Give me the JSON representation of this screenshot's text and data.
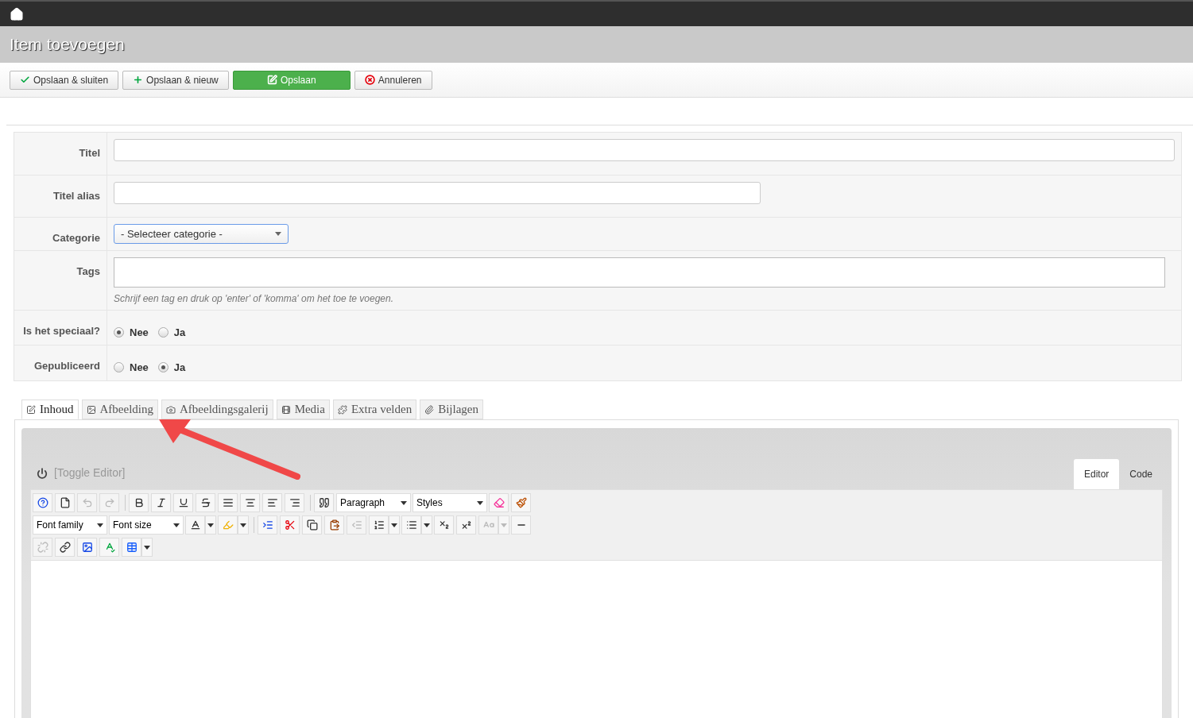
{
  "page_title": "Item toevoegen",
  "actions": [
    {
      "label": "Opslaan & sluiten",
      "kind": "check",
      "primary": false
    },
    {
      "label": "Opslaan & nieuw",
      "kind": "plus",
      "primary": false
    },
    {
      "label": "Opslaan",
      "kind": "edit",
      "primary": true
    },
    {
      "label": "Annuleren",
      "kind": "cancel",
      "primary": false
    }
  ],
  "form": [
    {
      "label": "Titel",
      "kind": "text-wide"
    },
    {
      "label": "Titel alias",
      "kind": "text"
    },
    {
      "label": "Categorie",
      "kind": "select",
      "value": "- Selecteer categorie -"
    },
    {
      "label": "Tags",
      "kind": "tags",
      "help": "Schrijf een tag en druk op 'enter' of 'komma' om het toe te voegen."
    },
    {
      "label": "Is het speciaal?",
      "kind": "radio",
      "options": [
        {
          "label": "Nee",
          "selected": true
        },
        {
          "label": "Ja",
          "selected": false
        }
      ]
    },
    {
      "label": "Gepubliceerd",
      "kind": "radio",
      "options": [
        {
          "label": "Nee",
          "selected": false
        },
        {
          "label": "Ja",
          "selected": true
        }
      ]
    }
  ],
  "tabs": [
    {
      "label": "Inhoud",
      "selected": true
    },
    {
      "label": "Afbeelding",
      "selected": false
    },
    {
      "label": "Afbeeldingsgalerij",
      "selected": false
    },
    {
      "label": "Media",
      "selected": false
    },
    {
      "label": "Extra velden",
      "selected": false
    },
    {
      "label": "Bijlagen",
      "selected": false
    }
  ],
  "editor": {
    "toggle": "[Toggle Editor]",
    "modes": [
      {
        "label": "Editor",
        "selected": true
      },
      {
        "label": "Code",
        "selected": false
      }
    ],
    "toolbar": [
      [
        {
          "kind": "button",
          "disabled": false
        },
        {
          "kind": "button",
          "disabled": false
        },
        {
          "kind": "button",
          "disabled": true
        },
        {
          "kind": "button",
          "disabled": true
        },
        {
          "kind": "separator"
        },
        {
          "kind": "button",
          "disabled": false
        },
        {
          "kind": "button",
          "disabled": false
        },
        {
          "kind": "button",
          "disabled": false
        },
        {
          "kind": "button",
          "disabled": false
        },
        {
          "kind": "button",
          "disabled": false
        },
        {
          "kind": "button",
          "disabled": false
        },
        {
          "kind": "button",
          "disabled": false
        },
        {
          "kind": "button",
          "disabled": false
        },
        {
          "kind": "separator"
        },
        {
          "kind": "button",
          "disabled": false
        },
        {
          "kind": "select",
          "label": "Paragraph"
        },
        {
          "kind": "select",
          "label": "Styles"
        },
        {
          "kind": "button",
          "disabled": false
        },
        {
          "kind": "button",
          "disabled": false
        }
      ],
      [
        {
          "kind": "select",
          "label": "Font family"
        },
        {
          "kind": "select",
          "label": "Font size"
        },
        {
          "kind": "split",
          "disabled": false
        },
        {
          "kind": "split",
          "disabled": false
        },
        {
          "kind": "separator"
        },
        {
          "kind": "button",
          "disabled": false
        },
        {
          "kind": "button",
          "disabled": false
        },
        {
          "kind": "button",
          "disabled": false
        },
        {
          "kind": "button",
          "disabled": false
        },
        {
          "kind": "button",
          "disabled": true
        },
        {
          "kind": "split",
          "disabled": false
        },
        {
          "kind": "split",
          "disabled": false
        },
        {
          "kind": "button",
          "disabled": false
        },
        {
          "kind": "button",
          "disabled": false
        },
        {
          "kind": "split",
          "disabled": true
        },
        {
          "kind": "button",
          "disabled": false
        }
      ],
      [
        {
          "kind": "button",
          "disabled": true
        },
        {
          "kind": "button",
          "disabled": false
        },
        {
          "kind": "button",
          "disabled": false
        },
        {
          "kind": "button",
          "disabled": false
        },
        {
          "kind": "split",
          "disabled": false
        }
      ]
    ]
  }
}
